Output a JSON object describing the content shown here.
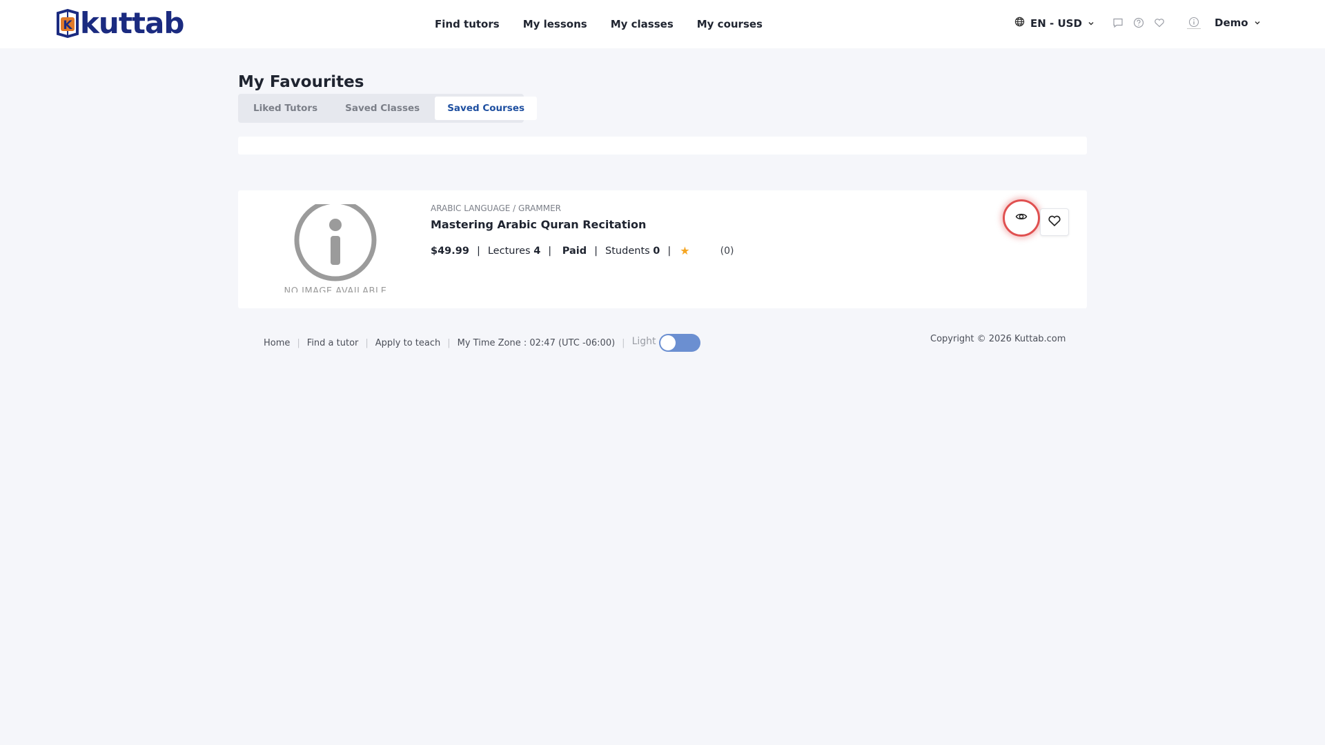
{
  "header": {
    "logo_text": "kuttab",
    "logo_letter": "K",
    "nav": [
      {
        "label": "Find tutors"
      },
      {
        "label": "My lessons"
      },
      {
        "label": "My classes"
      },
      {
        "label": "My courses"
      }
    ],
    "locale_label": "EN - USD",
    "user_label": "Demo"
  },
  "page": {
    "title": "My Favourites",
    "tabs": [
      {
        "label": "Liked Tutors",
        "active": false
      },
      {
        "label": "Saved Classes",
        "active": false
      },
      {
        "label": "Saved Courses",
        "active": true
      }
    ]
  },
  "course": {
    "no_image_text": "NO IMAGE AVAILABLE",
    "category": "ARABIC LANGUAGE / GRAMMER",
    "title": "Mastering Arabic Quran Recitation",
    "price": "$49.99",
    "lectures_label": "Lectures",
    "lectures_value": "4",
    "type": "Paid",
    "students_label": "Students",
    "students_value": "0",
    "rating_count": "(0)"
  },
  "footer": {
    "links": [
      "Home",
      "Find a tutor",
      "Apply to teach"
    ],
    "timezone": "My Time Zone : 02:47 (UTC -06:00)",
    "theme_label": "Light",
    "copyright": "Copyright © 2026 Kuttab.com"
  },
  "colors": {
    "brand": "#1b2b80",
    "accent": "#1e4fa0",
    "star": "#f5a623",
    "toggle": "#6b8fd1",
    "highlight": "#e05050"
  }
}
